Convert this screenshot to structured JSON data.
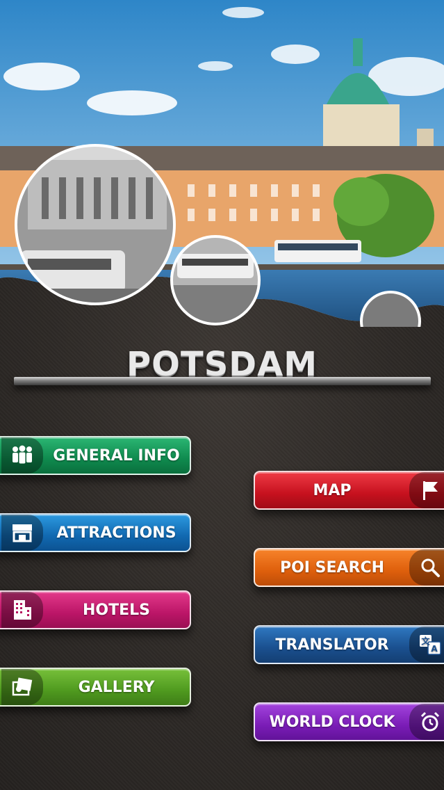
{
  "app": {
    "city_title": "POTSDAM"
  },
  "menu_left": [
    {
      "label": "GENERAL INFO",
      "icon": "people-icon",
      "color": "#1a9a5b"
    },
    {
      "label": "ATTRACTIONS",
      "icon": "storefront-icon",
      "color": "#1a78c3"
    },
    {
      "label": "HOTELS",
      "icon": "building-icon",
      "color": "#c81d72"
    },
    {
      "label": "GALLERY",
      "icon": "photos-icon",
      "color": "#5aa62a"
    }
  ],
  "menu_right": [
    {
      "label": "MAP",
      "icon": "flag-icon",
      "color": "#d11a26"
    },
    {
      "label": "POI SEARCH",
      "icon": "search-icon",
      "color": "#e86a14"
    },
    {
      "label": "TRANSLATOR",
      "icon": "translate-icon",
      "color": "#1f5aa0"
    },
    {
      "label": "WORLD CLOCK",
      "icon": "alarm-clock-icon",
      "color": "#8a24c4"
    }
  ]
}
